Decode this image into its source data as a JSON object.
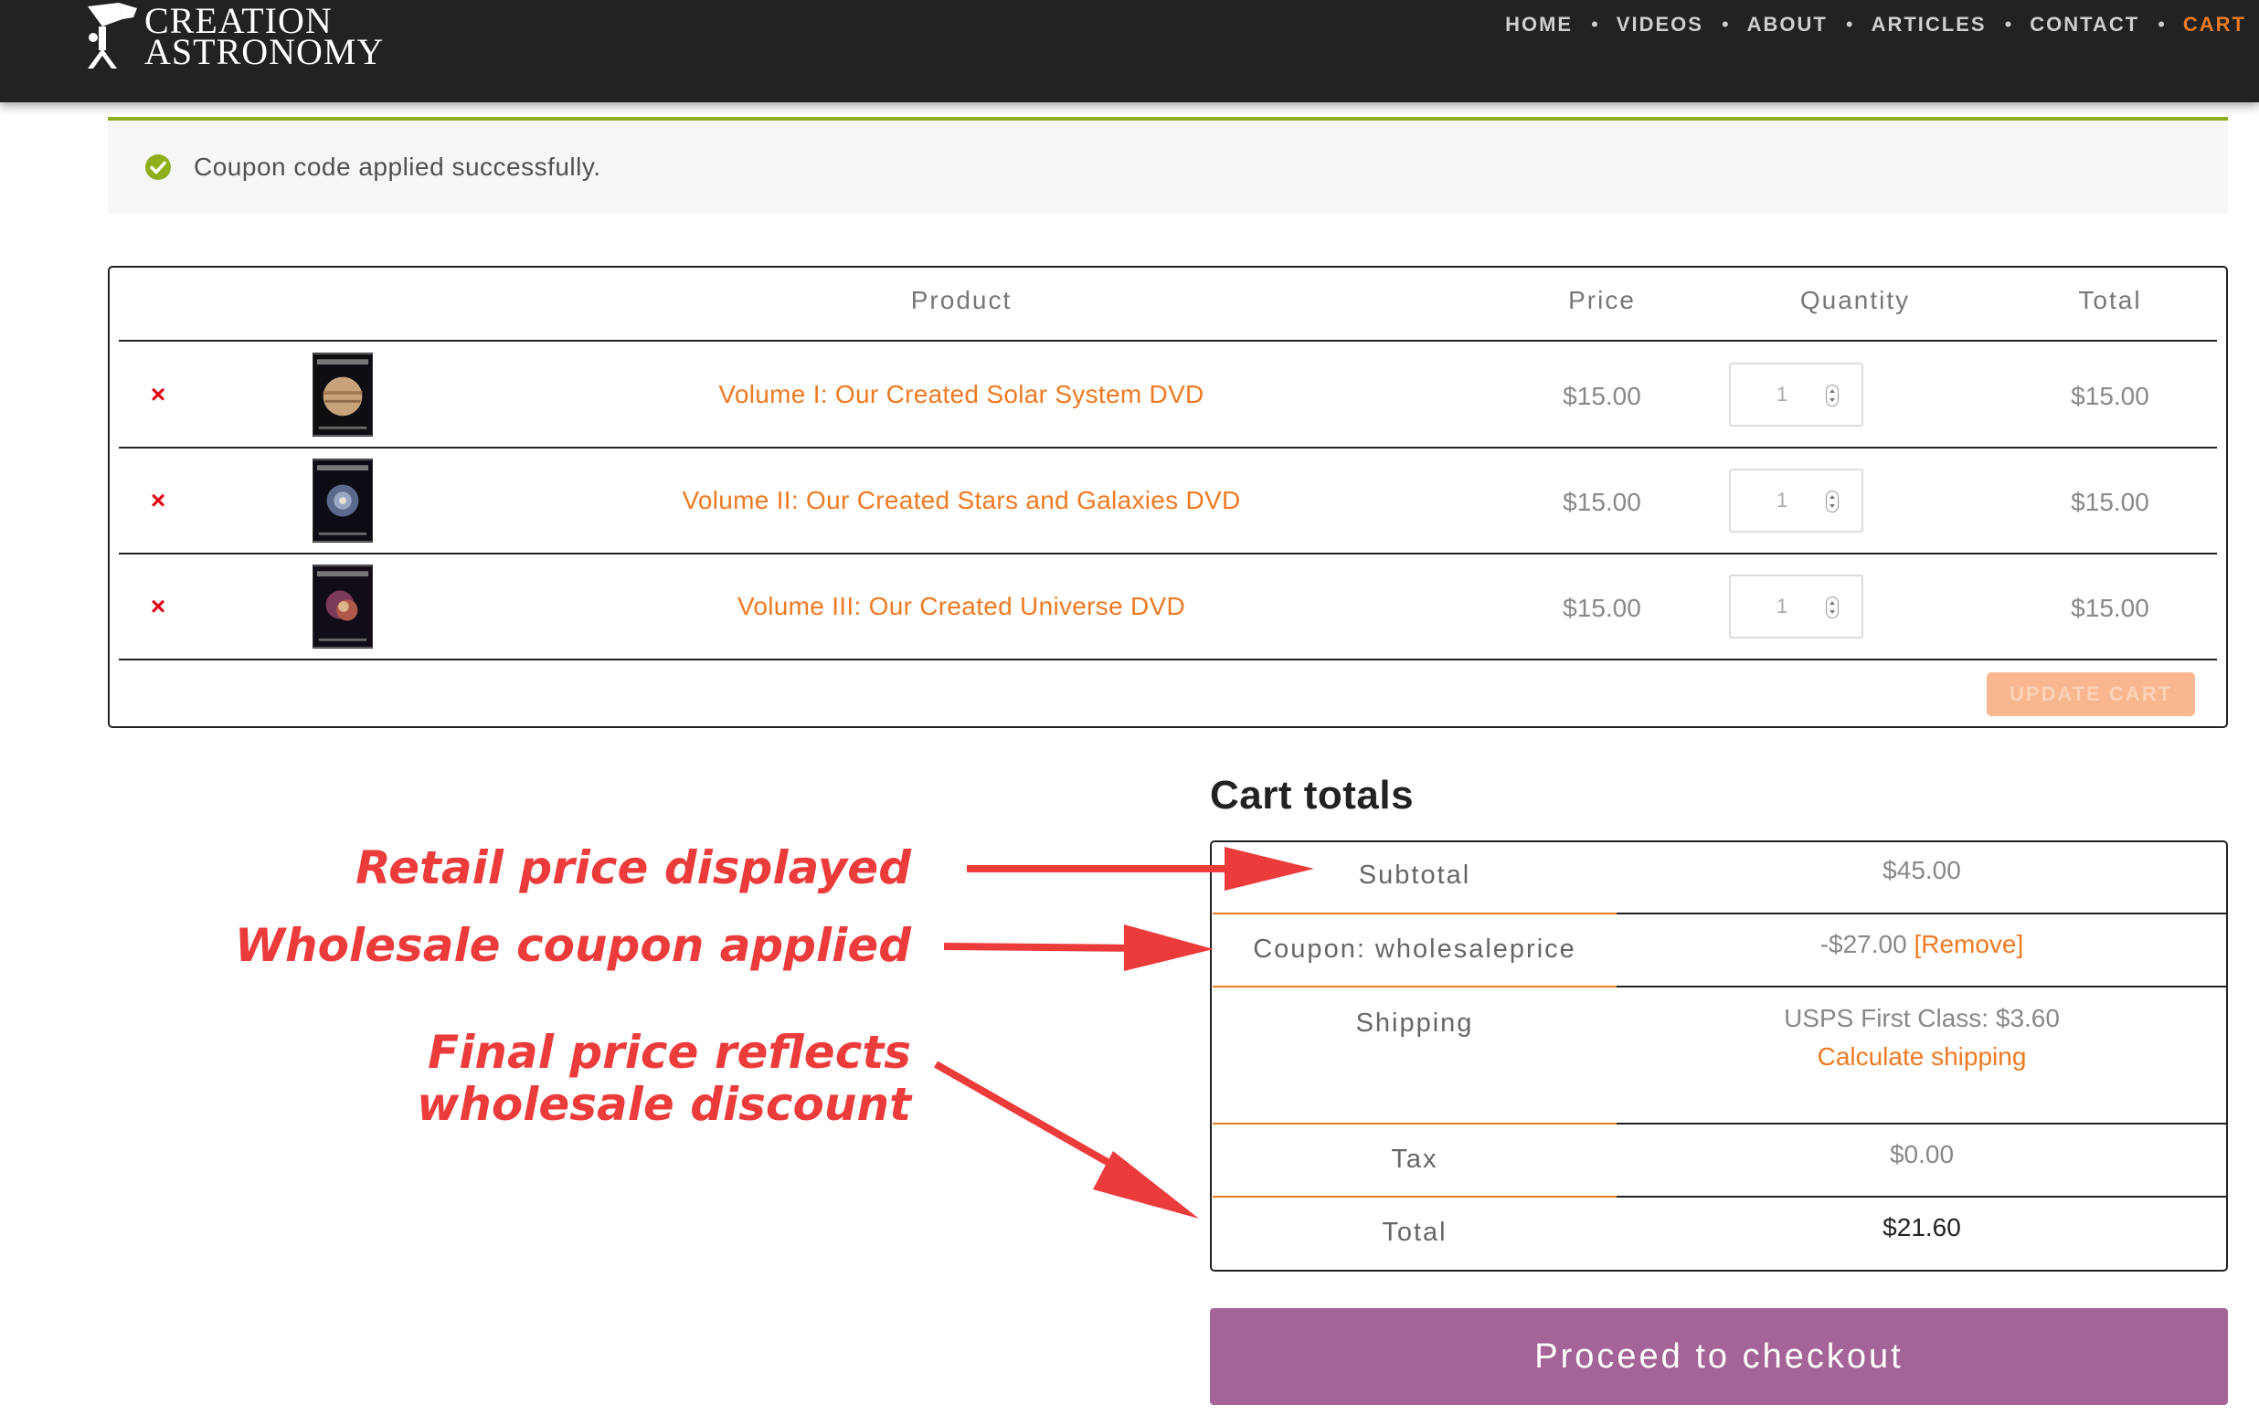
{
  "brand": {
    "line1": "CREATION",
    "line2": "ASTRONOMY"
  },
  "nav": {
    "items": [
      {
        "label": "HOME"
      },
      {
        "label": "VIDEOS"
      },
      {
        "label": "ABOUT"
      },
      {
        "label": "ARTICLES"
      },
      {
        "label": "CONTACT"
      },
      {
        "label": "CART",
        "active": true
      }
    ],
    "separator": "•"
  },
  "notice": {
    "text": "Coupon code applied successfully.",
    "icon": "check-circle-icon",
    "color": "#8fae1b"
  },
  "cart": {
    "headers": {
      "product": "Product",
      "price": "Price",
      "quantity": "Quantity",
      "total": "Total"
    },
    "remove_symbol": "×",
    "items": [
      {
        "name": "Volume I: Our Created Solar System DVD",
        "price": "$15.00",
        "quantity": "1",
        "total": "$15.00"
      },
      {
        "name": "Volume II: Our Created Stars and Galaxies DVD",
        "price": "$15.00",
        "quantity": "1",
        "total": "$15.00"
      },
      {
        "name": "Volume III: Our Created Universe DVD",
        "price": "$15.00",
        "quantity": "1",
        "total": "$15.00"
      }
    ],
    "update_label": "UPDATE CART"
  },
  "totals": {
    "title": "Cart totals",
    "subtotal_label": "Subtotal",
    "subtotal_value": "$45.00",
    "coupon_label": "Coupon: wholesaleprice",
    "coupon_value": "-$27.00",
    "coupon_remove": "[Remove]",
    "shipping_label": "Shipping",
    "shipping_value": "USPS First Class: $3.60",
    "shipping_link": "Calculate shipping",
    "tax_label": "Tax",
    "tax_value": "$0.00",
    "total_label": "Total",
    "total_value": "$21.60"
  },
  "checkout_label": "Proceed to checkout",
  "annotations": {
    "retail": "Retail price displayed",
    "wholesale": "Wholesale coupon applied",
    "final_line1": "Final price reflects",
    "final_line2": "wholesale discount",
    "color": "#ec3b3b"
  },
  "colors": {
    "accent": "#ee7a22",
    "checkout": "#a46497",
    "header": "#222222"
  }
}
